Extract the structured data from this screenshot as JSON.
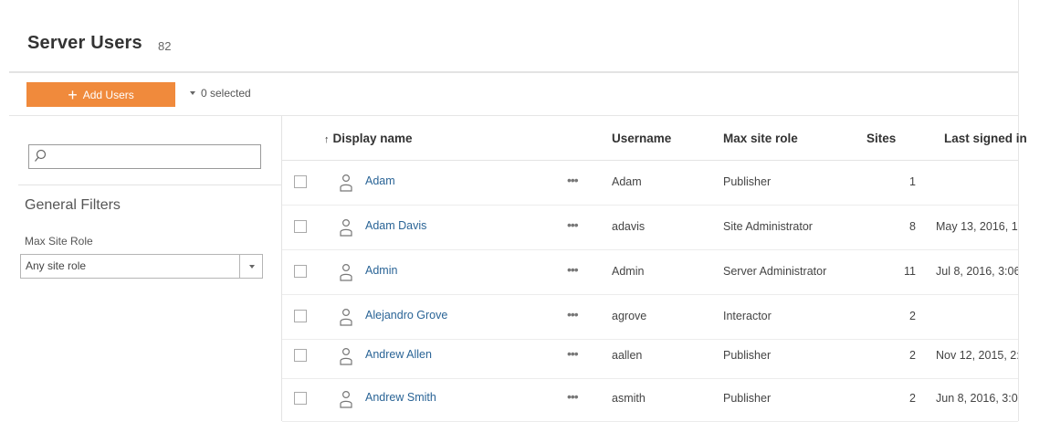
{
  "page": {
    "title": "Server Users",
    "user_count": "82"
  },
  "toolbar": {
    "add_users_label": "Add Users",
    "selection_label": "0 selected"
  },
  "sidebar": {
    "search_placeholder": "",
    "filters_heading": "General Filters",
    "role_filter_label": "Max Site Role",
    "role_filter_value": "Any site role"
  },
  "table": {
    "sort_indicator": "↑",
    "columns": {
      "display_name": "Display name",
      "username": "Username",
      "max_site_role": "Max site role",
      "sites": "Sites",
      "last_signed_in": "Last signed in"
    },
    "more_actions_glyph": "•••",
    "rows": [
      {
        "display_name": "Adam",
        "username": "Adam",
        "role": "Publisher",
        "sites": "1",
        "last_signed_in": ""
      },
      {
        "display_name": "Adam Davis",
        "username": "adavis",
        "role": "Site Administrator",
        "sites": "8",
        "last_signed_in": "May 13, 2016, 1"
      },
      {
        "display_name": "Admin",
        "username": "Admin",
        "role": "Server Administrator",
        "sites": "11",
        "last_signed_in": "Jul 8, 2016, 3:06"
      },
      {
        "display_name": "Alejandro Grove",
        "username": "agrove",
        "role": "Interactor",
        "sites": "2",
        "last_signed_in": ""
      },
      {
        "display_name": "Andrew Allen",
        "username": "aallen",
        "role": "Publisher",
        "sites": "2",
        "last_signed_in": "Nov 12, 2015, 2:"
      },
      {
        "display_name": "Andrew Smith",
        "username": "asmith",
        "role": "Publisher",
        "sites": "2",
        "last_signed_in": "Jun 8, 2016, 3:0"
      }
    ]
  },
  "colors": {
    "accent": "#f08a3c",
    "link": "#2a6496",
    "text": "#333333"
  },
  "icons": {
    "add": "plus-icon",
    "search": "search-icon",
    "user": "user-icon",
    "more": "more-icon",
    "dropdown": "caret-down-icon"
  }
}
